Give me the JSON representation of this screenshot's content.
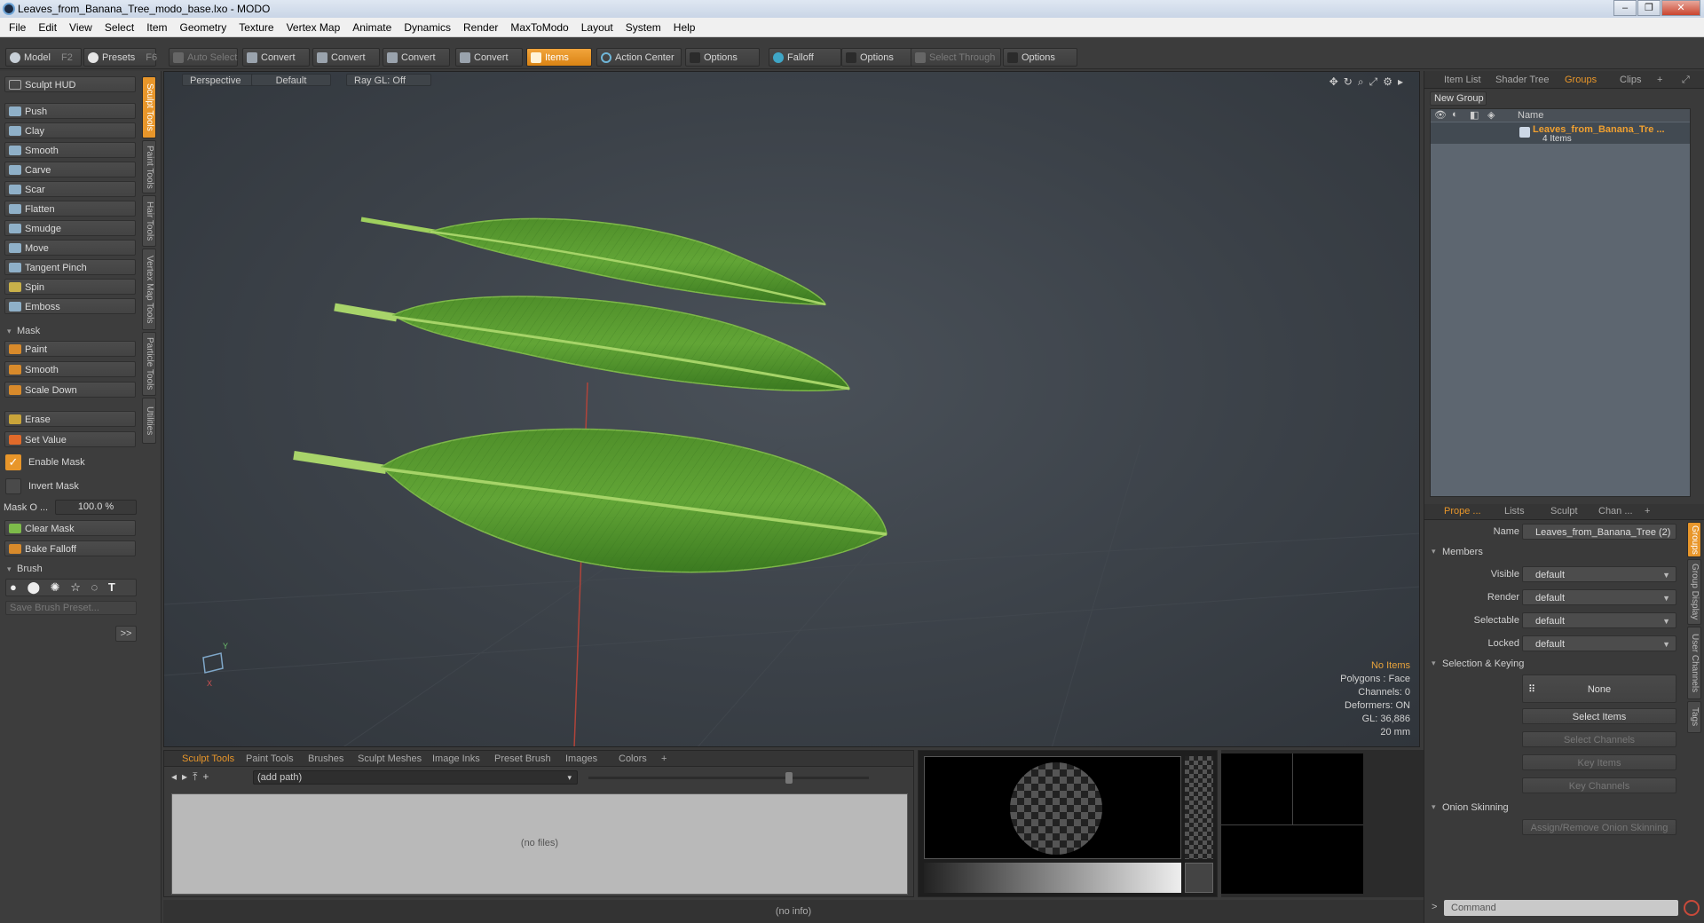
{
  "window": {
    "title": "Leaves_from_Banana_Tree_modo_base.lxo - MODO",
    "controls": [
      "–",
      "❐",
      "✕"
    ]
  },
  "menu": [
    "File",
    "Edit",
    "View",
    "Select",
    "Item",
    "Geometry",
    "Texture",
    "Vertex Map",
    "Animate",
    "Dynamics",
    "Render",
    "MaxToModo",
    "Layout",
    "System",
    "Help"
  ],
  "toolbar": {
    "model": "Model",
    "model_key": "F2",
    "presets": "Presets",
    "presets_key": "F6",
    "auto_select": "Auto Select",
    "convert1": "Convert",
    "convert2": "Convert",
    "convert3": "Convert",
    "convert4": "Convert",
    "items": "Items",
    "action_center": "Action Center",
    "options1": "Options",
    "falloff": "Falloff",
    "options2": "Options",
    "select_through": "Select Through",
    "options3": "Options"
  },
  "left": {
    "sculpt_hud": "Sculpt HUD",
    "tools": [
      "Push",
      "Clay",
      "Smooth",
      "Carve",
      "Scar",
      "Flatten",
      "Smudge",
      "Move",
      "Tangent Pinch",
      "Spin",
      "Emboss"
    ],
    "mask_section": "Mask",
    "mask_tools": [
      "Paint",
      "Smooth",
      "Scale Down"
    ],
    "erase": "Erase",
    "set_value": "Set Value",
    "enable_mask": "Enable Mask",
    "invert_mask": "Invert Mask",
    "mask_opacity_label": "Mask O ...",
    "mask_opacity_value": "100.0 %",
    "clear_mask": "Clear Mask",
    "bake_falloff": "Bake Falloff",
    "brush_section": "Brush",
    "save_brush": "Save Brush Preset...",
    "more": ">>",
    "vtabs": [
      "Sculpt Tools",
      "Paint Tools",
      "Hair Tools",
      "Vertex Map Tools",
      "Particle Tools",
      "Utilities"
    ]
  },
  "viewport": {
    "view": "Perspective",
    "shading": "Default",
    "raygl": "Ray GL: Off",
    "stats": {
      "items": "No Items",
      "polygons": "Polygons : Face",
      "channels": "Channels: 0",
      "deformers": "Deformers: ON",
      "gl": "GL: 36,886",
      "scale": "20 mm"
    }
  },
  "bottom": {
    "tabs": [
      "Sculpt Tools",
      "Paint Tools",
      "Brushes",
      "Sculpt Meshes",
      "Image Inks",
      "Preset Brush",
      "Images",
      "Colors"
    ],
    "add_tab": "+",
    "path": "(add path)",
    "no_files": "(no files)",
    "status": "(no info)"
  },
  "right": {
    "top_tabs": [
      "Item List",
      "Shader Tree",
      "Groups",
      "Clips"
    ],
    "new_group": "New Group",
    "col_name": "Name",
    "group_name": "Leaves_from_Banana_Tre ...",
    "group_count": "4 Items",
    "prop_tabs": [
      "Prope ...",
      "Lists",
      "Sculpt",
      "Chan ..."
    ],
    "name_label": "Name",
    "name_value": "Leaves_from_Banana_Tree (2)",
    "members": "Members",
    "visible_label": "Visible",
    "visible_value": "default",
    "render_label": "Render",
    "render_value": "default",
    "selectable_label": "Selectable",
    "selectable_value": "default",
    "locked_label": "Locked",
    "locked_value": "default",
    "sel_keying": "Selection & Keying",
    "none_btn": "None",
    "select_items": "Select Items",
    "select_channels": "Select Channels",
    "key_items": "Key Items",
    "key_channels": "Key Channels",
    "onion": "Onion Skinning",
    "onion_btn": "Assign/Remove Onion Skinning",
    "vtabs": [
      "Groups",
      "Group Display",
      "User Channels",
      "Tags"
    ],
    "command_placeholder": "Command"
  },
  "colors": {
    "accent": "#e8962a",
    "leaf": "#5fa133",
    "leaf_dark": "#2f6b1c",
    "stem": "#a8d46a"
  }
}
